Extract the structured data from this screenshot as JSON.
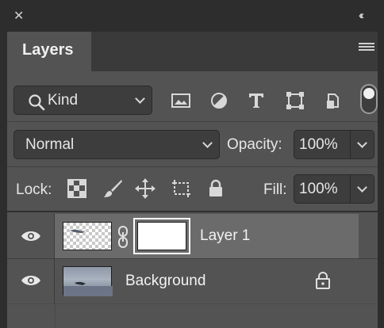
{
  "panel": {
    "close_glyph": "✕",
    "collapse_glyph": "‹‹",
    "tab_label": "Layers",
    "menu_icon": "panel-menu-icon"
  },
  "filter": {
    "kind_label": "Kind",
    "icons": [
      "image-filter-icon",
      "adjustment-filter-icon",
      "type-filter-icon",
      "shape-filter-icon",
      "smart-object-filter-icon"
    ],
    "toggle_on": true
  },
  "blend": {
    "mode": "Normal",
    "opacity_label": "Opacity:",
    "opacity_value": "100%"
  },
  "lock": {
    "label": "Lock:",
    "icons": [
      "lock-transparent-pixels-icon",
      "lock-image-pixels-icon",
      "lock-position-icon",
      "lock-artboard-icon",
      "lock-all-icon"
    ],
    "fill_label": "Fill:",
    "fill_value": "100%"
  },
  "layers": [
    {
      "name": "Layer 1",
      "visible": true,
      "selected": true,
      "has_mask": true,
      "locked": false
    },
    {
      "name": "Background",
      "visible": true,
      "selected": false,
      "has_mask": false,
      "locked": true
    }
  ],
  "colors": {
    "panel_bg": "#535353",
    "frame": "#2d2d2d",
    "field_bg": "#3d3d3d",
    "selected_row": "#6b6b6b",
    "text": "#e8e8e8"
  }
}
